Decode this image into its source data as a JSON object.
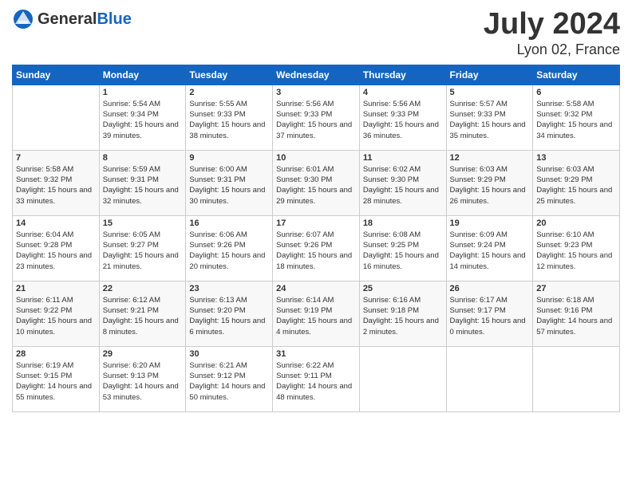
{
  "header": {
    "logo_general": "General",
    "logo_blue": "Blue",
    "month": "July 2024",
    "location": "Lyon 02, France"
  },
  "days_of_week": [
    "Sunday",
    "Monday",
    "Tuesday",
    "Wednesday",
    "Thursday",
    "Friday",
    "Saturday"
  ],
  "weeks": [
    [
      {
        "day": "",
        "sunrise": "",
        "sunset": "",
        "daylight": ""
      },
      {
        "day": "1",
        "sunrise": "Sunrise: 5:54 AM",
        "sunset": "Sunset: 9:34 PM",
        "daylight": "Daylight: 15 hours and 39 minutes."
      },
      {
        "day": "2",
        "sunrise": "Sunrise: 5:55 AM",
        "sunset": "Sunset: 9:33 PM",
        "daylight": "Daylight: 15 hours and 38 minutes."
      },
      {
        "day": "3",
        "sunrise": "Sunrise: 5:56 AM",
        "sunset": "Sunset: 9:33 PM",
        "daylight": "Daylight: 15 hours and 37 minutes."
      },
      {
        "day": "4",
        "sunrise": "Sunrise: 5:56 AM",
        "sunset": "Sunset: 9:33 PM",
        "daylight": "Daylight: 15 hours and 36 minutes."
      },
      {
        "day": "5",
        "sunrise": "Sunrise: 5:57 AM",
        "sunset": "Sunset: 9:33 PM",
        "daylight": "Daylight: 15 hours and 35 minutes."
      },
      {
        "day": "6",
        "sunrise": "Sunrise: 5:58 AM",
        "sunset": "Sunset: 9:32 PM",
        "daylight": "Daylight: 15 hours and 34 minutes."
      }
    ],
    [
      {
        "day": "7",
        "sunrise": "Sunrise: 5:58 AM",
        "sunset": "Sunset: 9:32 PM",
        "daylight": "Daylight: 15 hours and 33 minutes."
      },
      {
        "day": "8",
        "sunrise": "Sunrise: 5:59 AM",
        "sunset": "Sunset: 9:31 PM",
        "daylight": "Daylight: 15 hours and 32 minutes."
      },
      {
        "day": "9",
        "sunrise": "Sunrise: 6:00 AM",
        "sunset": "Sunset: 9:31 PM",
        "daylight": "Daylight: 15 hours and 30 minutes."
      },
      {
        "day": "10",
        "sunrise": "Sunrise: 6:01 AM",
        "sunset": "Sunset: 9:30 PM",
        "daylight": "Daylight: 15 hours and 29 minutes."
      },
      {
        "day": "11",
        "sunrise": "Sunrise: 6:02 AM",
        "sunset": "Sunset: 9:30 PM",
        "daylight": "Daylight: 15 hours and 28 minutes."
      },
      {
        "day": "12",
        "sunrise": "Sunrise: 6:03 AM",
        "sunset": "Sunset: 9:29 PM",
        "daylight": "Daylight: 15 hours and 26 minutes."
      },
      {
        "day": "13",
        "sunrise": "Sunrise: 6:03 AM",
        "sunset": "Sunset: 9:29 PM",
        "daylight": "Daylight: 15 hours and 25 minutes."
      }
    ],
    [
      {
        "day": "14",
        "sunrise": "Sunrise: 6:04 AM",
        "sunset": "Sunset: 9:28 PM",
        "daylight": "Daylight: 15 hours and 23 minutes."
      },
      {
        "day": "15",
        "sunrise": "Sunrise: 6:05 AM",
        "sunset": "Sunset: 9:27 PM",
        "daylight": "Daylight: 15 hours and 21 minutes."
      },
      {
        "day": "16",
        "sunrise": "Sunrise: 6:06 AM",
        "sunset": "Sunset: 9:26 PM",
        "daylight": "Daylight: 15 hours and 20 minutes."
      },
      {
        "day": "17",
        "sunrise": "Sunrise: 6:07 AM",
        "sunset": "Sunset: 9:26 PM",
        "daylight": "Daylight: 15 hours and 18 minutes."
      },
      {
        "day": "18",
        "sunrise": "Sunrise: 6:08 AM",
        "sunset": "Sunset: 9:25 PM",
        "daylight": "Daylight: 15 hours and 16 minutes."
      },
      {
        "day": "19",
        "sunrise": "Sunrise: 6:09 AM",
        "sunset": "Sunset: 9:24 PM",
        "daylight": "Daylight: 15 hours and 14 minutes."
      },
      {
        "day": "20",
        "sunrise": "Sunrise: 6:10 AM",
        "sunset": "Sunset: 9:23 PM",
        "daylight": "Daylight: 15 hours and 12 minutes."
      }
    ],
    [
      {
        "day": "21",
        "sunrise": "Sunrise: 6:11 AM",
        "sunset": "Sunset: 9:22 PM",
        "daylight": "Daylight: 15 hours and 10 minutes."
      },
      {
        "day": "22",
        "sunrise": "Sunrise: 6:12 AM",
        "sunset": "Sunset: 9:21 PM",
        "daylight": "Daylight: 15 hours and 8 minutes."
      },
      {
        "day": "23",
        "sunrise": "Sunrise: 6:13 AM",
        "sunset": "Sunset: 9:20 PM",
        "daylight": "Daylight: 15 hours and 6 minutes."
      },
      {
        "day": "24",
        "sunrise": "Sunrise: 6:14 AM",
        "sunset": "Sunset: 9:19 PM",
        "daylight": "Daylight: 15 hours and 4 minutes."
      },
      {
        "day": "25",
        "sunrise": "Sunrise: 6:16 AM",
        "sunset": "Sunset: 9:18 PM",
        "daylight": "Daylight: 15 hours and 2 minutes."
      },
      {
        "day": "26",
        "sunrise": "Sunrise: 6:17 AM",
        "sunset": "Sunset: 9:17 PM",
        "daylight": "Daylight: 15 hours and 0 minutes."
      },
      {
        "day": "27",
        "sunrise": "Sunrise: 6:18 AM",
        "sunset": "Sunset: 9:16 PM",
        "daylight": "Daylight: 14 hours and 57 minutes."
      }
    ],
    [
      {
        "day": "28",
        "sunrise": "Sunrise: 6:19 AM",
        "sunset": "Sunset: 9:15 PM",
        "daylight": "Daylight: 14 hours and 55 minutes."
      },
      {
        "day": "29",
        "sunrise": "Sunrise: 6:20 AM",
        "sunset": "Sunset: 9:13 PM",
        "daylight": "Daylight: 14 hours and 53 minutes."
      },
      {
        "day": "30",
        "sunrise": "Sunrise: 6:21 AM",
        "sunset": "Sunset: 9:12 PM",
        "daylight": "Daylight: 14 hours and 50 minutes."
      },
      {
        "day": "31",
        "sunrise": "Sunrise: 6:22 AM",
        "sunset": "Sunset: 9:11 PM",
        "daylight": "Daylight: 14 hours and 48 minutes."
      },
      {
        "day": "",
        "sunrise": "",
        "sunset": "",
        "daylight": ""
      },
      {
        "day": "",
        "sunrise": "",
        "sunset": "",
        "daylight": ""
      },
      {
        "day": "",
        "sunrise": "",
        "sunset": "",
        "daylight": ""
      }
    ]
  ]
}
